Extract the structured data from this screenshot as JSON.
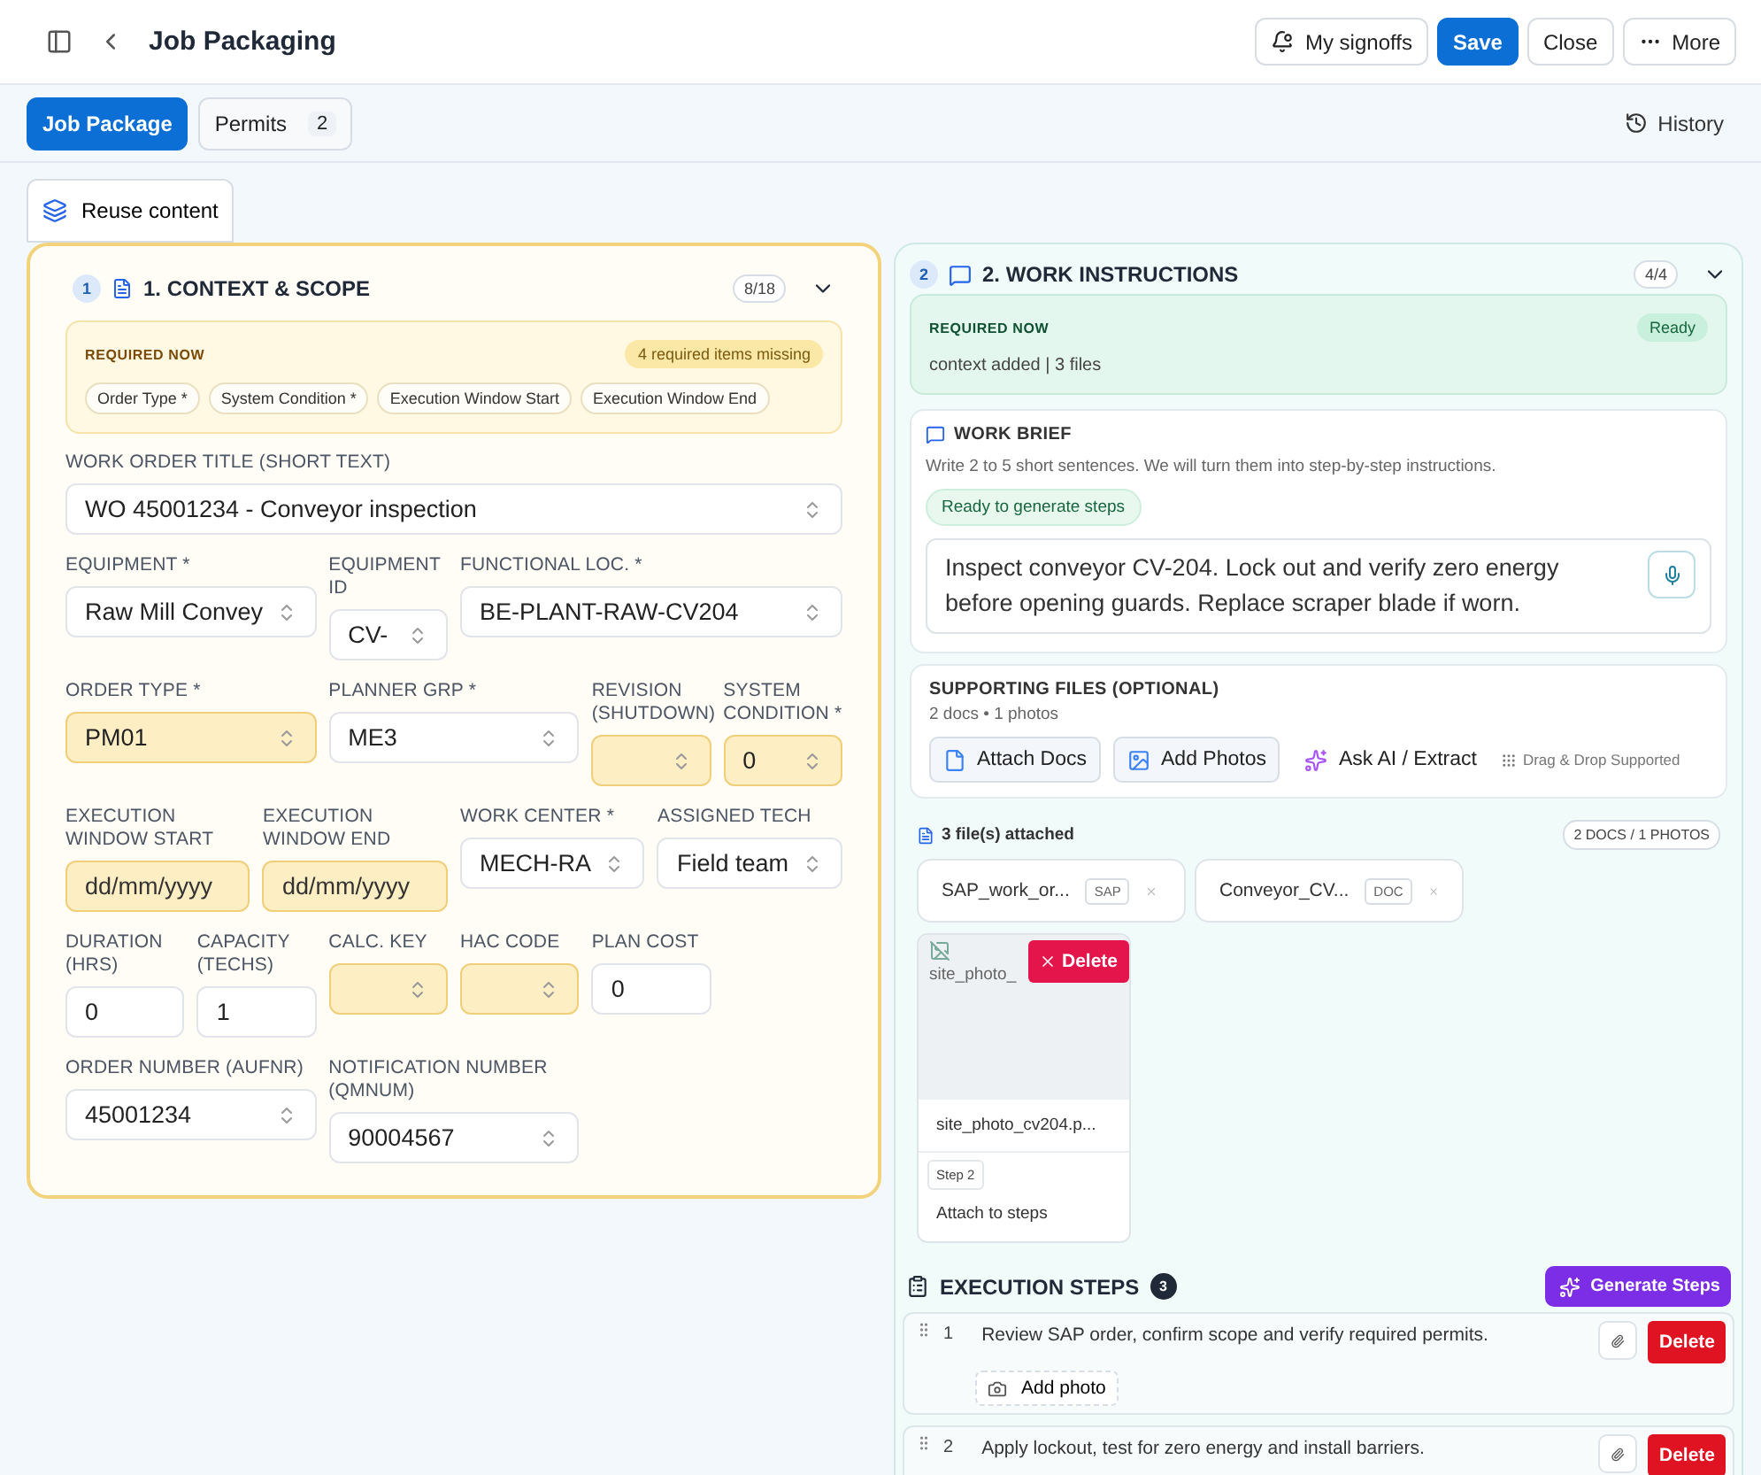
{
  "header": {
    "title": "Job Packaging",
    "actions": [
      {
        "label": "My signoffs",
        "kind": "bell"
      },
      {
        "label": "Save",
        "kind": "primary"
      },
      {
        "label": "Close",
        "kind": "plain"
      },
      {
        "label": "More",
        "kind": "menu"
      }
    ]
  },
  "tabs": [
    {
      "label": "Job Package",
      "selected": true
    },
    {
      "label": "Permits",
      "count": "2",
      "selected": false
    }
  ],
  "history": "History",
  "reuse_button": "Reuse content",
  "context": {
    "index": "1",
    "title": "1. CONTEXT & SCOPE",
    "progress": "8/18",
    "expanded": true,
    "required": {
      "kind": "warning",
      "heading": "REQUIRED NOW",
      "status": "4 required items missing",
      "items": [
        "Order Type *",
        "System Condition *",
        "Execution Window Start",
        "Execution Window End"
      ]
    },
    "fields": [
      {
        "label": "WORK ORDER TITLE (SHORT TEXT)",
        "value": "WO 45001234 - Conveyor inspection",
        "kind": "select",
        "missing": false
      },
      {
        "label": "EQUIPMENT *",
        "value": "Raw Mill Convey",
        "kind": "select",
        "missing": false
      },
      {
        "label": "EQUIPMENT ID",
        "value": "CV-",
        "kind": "select",
        "missing": false
      },
      {
        "label": "FUNCTIONAL LOC. *",
        "value": "BE-PLANT-RAW-CV204",
        "kind": "select",
        "missing": false
      },
      {
        "label": "ORDER TYPE *",
        "value": "PM01",
        "kind": "select",
        "missing": true
      },
      {
        "label": "PLANNER GRP *",
        "value": "ME3",
        "kind": "select",
        "missing": false
      },
      {
        "label": "REVISION (SHUTDOWN)",
        "kind": "select",
        "missing": true
      },
      {
        "label": "SYSTEM CONDITION *",
        "value": "0",
        "kind": "select",
        "missing": true
      },
      {
        "label": "EXECUTION WINDOW START",
        "placeholder": "dd/mm/yyyy",
        "kind": "date",
        "missing": true
      },
      {
        "label": "EXECUTION WINDOW END",
        "placeholder": "dd/mm/yyyy",
        "kind": "date",
        "missing": true
      },
      {
        "label": "WORK CENTER *",
        "value": "MECH-RA",
        "kind": "select",
        "missing": false
      },
      {
        "label": "ASSIGNED TECH",
        "value": "Field team",
        "kind": "select",
        "missing": false
      },
      {
        "label": "DURATION (HRS)",
        "value": "0",
        "kind": "input",
        "missing": false
      },
      {
        "label": "CAPACITY (TECHS)",
        "value": "1",
        "kind": "input",
        "missing": false
      },
      {
        "label": "CALC. KEY",
        "kind": "select",
        "missing": true
      },
      {
        "label": "HAC CODE",
        "kind": "select",
        "missing": true
      },
      {
        "label": "PLAN COST",
        "value": "0",
        "kind": "input",
        "missing": false
      },
      {
        "label": "ORDER NUMBER (AUFNR)",
        "value": "45001234",
        "kind": "select",
        "missing": false
      },
      {
        "label": "NOTIFICATION NUMBER (QMNUM)",
        "value": "90004567",
        "kind": "select",
        "missing": false
      }
    ]
  },
  "instructions": {
    "index": "2",
    "title": "2. WORK INSTRUCTIONS",
    "progress": "4/4",
    "expanded": true,
    "required": {
      "kind": "success",
      "heading": "REQUIRED NOW",
      "status": "Ready",
      "summary": "context added | 3 files"
    },
    "brief": {
      "title": "WORK BRIEF",
      "hint": "Write 2 to 5 short sentences. We will turn them into step-by-step instructions.",
      "status": "Ready to generate steps",
      "value": "Inspect conveyor CV-204. Lock out and verify zero energy before opening guards. Replace scraper blade if worn."
    },
    "files": {
      "title": "SUPPORTING FILES (OPTIONAL)",
      "summary": "2 docs • 1 photos",
      "actions": [
        {
          "label": "Attach Docs",
          "kind": "doc"
        },
        {
          "label": "Add Photos",
          "kind": "image"
        },
        {
          "label": "Ask AI / Extract",
          "kind": "ai"
        }
      ],
      "drop_hint": "Drag & Drop Supported"
    },
    "attached": {
      "summary": "3 file(s) attached",
      "counts": "2 DOCS / 1 PHOTOS",
      "docs": [
        {
          "name": "SAP_work_or...",
          "tag": "SAP"
        },
        {
          "name": "Conveyor_CV...",
          "tag": "DOC"
        }
      ],
      "photos": [
        {
          "alt": "site_photo_",
          "delete": "Delete",
          "name": "site_photo_cv204.p...",
          "step": "Step 2",
          "action": "Attach to steps"
        }
      ]
    },
    "steps": {
      "title": "EXECUTION STEPS",
      "count": "3",
      "generate": "Generate Steps",
      "items": [
        {
          "number": "1",
          "text": "Review SAP order, confirm scope and verify required permits.",
          "delete": "Delete",
          "add_photo": "Add photo"
        },
        {
          "number": "2",
          "text": "Apply lockout, test for zero energy and install barriers.",
          "delete": "Delete"
        }
      ]
    }
  }
}
